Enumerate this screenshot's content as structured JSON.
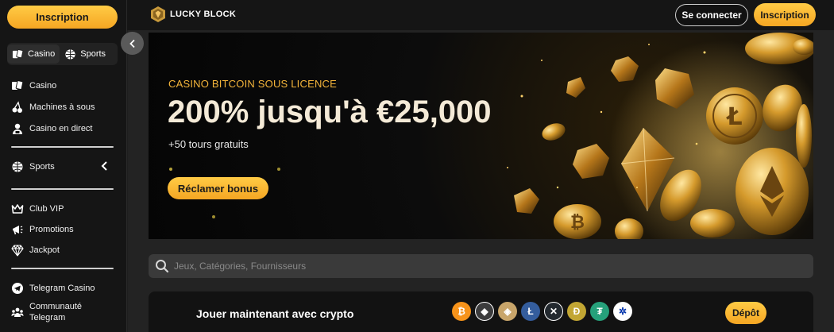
{
  "sidebar": {
    "signup_label": "Inscription",
    "switch": {
      "casino": "Casino",
      "sports": "Sports"
    },
    "items": [
      {
        "label": "Casino",
        "icon": "cards-icon"
      },
      {
        "label": "Machines à sous",
        "icon": "cherries-icon"
      },
      {
        "label": "Casino en direct",
        "icon": "live-dealer-icon"
      },
      {
        "label": "Sports",
        "icon": "ball-icon"
      },
      {
        "label": "Club VIP",
        "icon": "crown-icon"
      },
      {
        "label": "Promotions",
        "icon": "megaphone-icon"
      },
      {
        "label": "Jackpot",
        "icon": "diamond-icon"
      },
      {
        "label": "Telegram Casino",
        "icon": "telegram-icon"
      },
      {
        "label": "Communauté Telegram",
        "icon": "community-icon"
      }
    ]
  },
  "header": {
    "logo_text": "LUCKY BLOCK",
    "login_label": "Se connecter",
    "signup_label": "Inscription"
  },
  "banner": {
    "subtitle": "CASINO BITCOIN SOUS LICENCE",
    "title": "200% jusqu'à €25,000",
    "spins": "+50 tours gratuits",
    "claim_label": "Réclamer bonus"
  },
  "search": {
    "placeholder": "Jeux, Catégories, Fournisseurs"
  },
  "crypto": {
    "text": "Jouer maintenant avec crypto",
    "deposit_label": "Dépôt",
    "coins": [
      {
        "name": "bitcoin-icon",
        "symbol": "₿",
        "color": "#f7931a"
      },
      {
        "name": "ethereum-icon",
        "symbol": "◆",
        "color": "#3c3c3d"
      },
      {
        "name": "lucky-block-coin-icon",
        "symbol": "◈",
        "color": "#c8a56a"
      },
      {
        "name": "litecoin-icon",
        "symbol": "Ł",
        "color": "#345d9d"
      },
      {
        "name": "xrp-icon",
        "symbol": "✕",
        "color": "#23292f"
      },
      {
        "name": "dogecoin-icon",
        "symbol": "Ð",
        "color": "#c2a633"
      },
      {
        "name": "tether-icon",
        "symbol": "₮",
        "color": "#26a17b"
      },
      {
        "name": "cardano-icon",
        "symbol": "✲",
        "color": "#ffffff"
      }
    ]
  },
  "colors": {
    "accent": "#f5a623",
    "background": "#1e1e1e",
    "sidebar": "#151515"
  }
}
